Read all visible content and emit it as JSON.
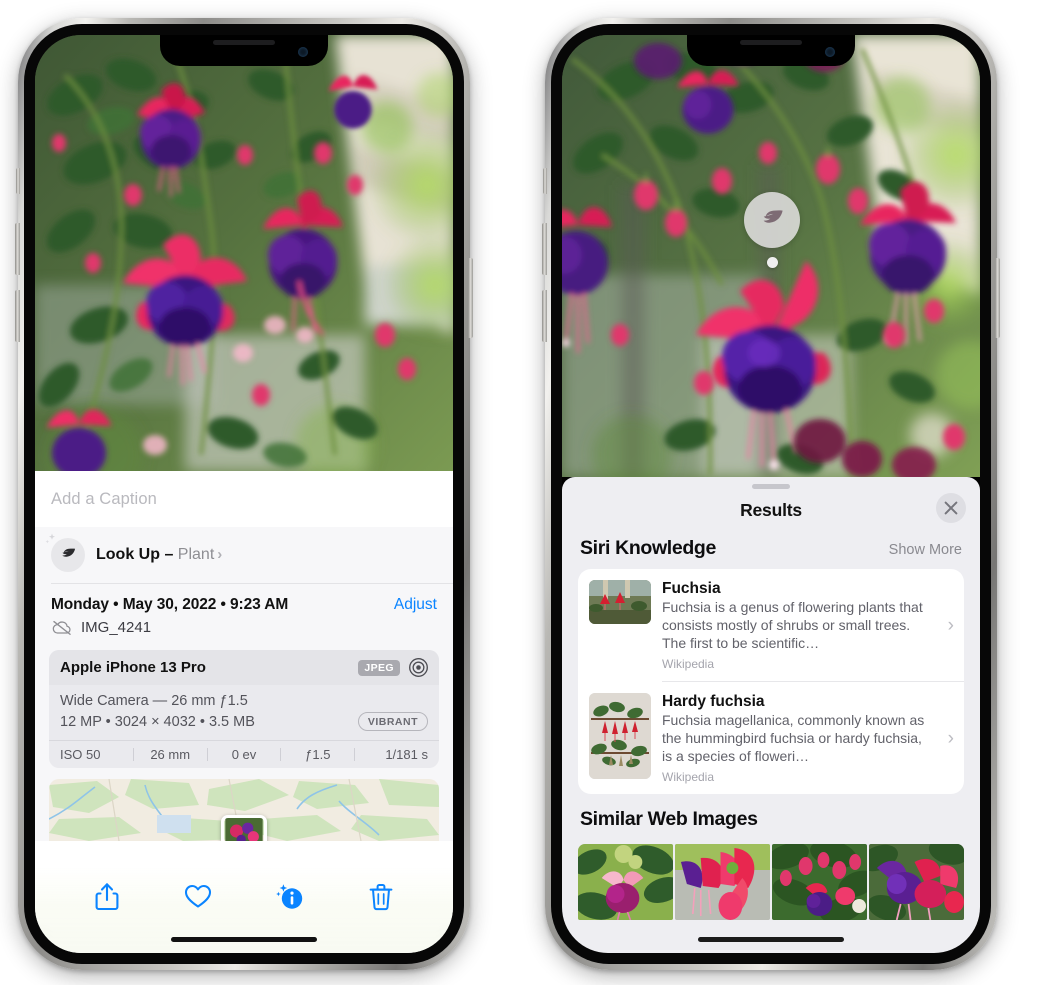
{
  "left_phone": {
    "caption_field": {
      "placeholder": "Add a Caption",
      "value": ""
    },
    "lookup_row": {
      "label": "Look Up –",
      "subject": "Plant",
      "chevron": "›",
      "icon": "leaf-sparkle-icon"
    },
    "metadata": {
      "date_line": "Monday • May 30, 2022 • 9:23 AM",
      "adjust_label": "Adjust",
      "filename": "IMG_4241",
      "cloud_icon": "cloud-slash-icon"
    },
    "camera_card": {
      "device": "Apple iPhone 13 Pro",
      "format_badge": "JPEG",
      "aperture_icon": "aperture-icon",
      "lens": "Wide Camera — 26 mm ƒ1.5",
      "specs": "12 MP • 3024 × 4032 • 3.5 MB",
      "style_badge": "VIBRANT",
      "exif": [
        "ISO 50",
        "26 mm",
        "0 ev",
        "ƒ1.5",
        "1/181 s"
      ]
    },
    "toolbar": [
      {
        "name": "share-button",
        "icon": "share-icon"
      },
      {
        "name": "favorite-button",
        "icon": "heart-icon"
      },
      {
        "name": "info-button",
        "icon": "info-sparkle-icon",
        "active": true
      },
      {
        "name": "delete-button",
        "icon": "trash-icon"
      }
    ]
  },
  "right_phone": {
    "badge": {
      "icon": "leaf-icon",
      "name": "visual-lookup-badge"
    },
    "sheet": {
      "title": "Results",
      "close_icon": "close-icon",
      "grabber": "drag-handle"
    },
    "siri_knowledge": {
      "title": "Siri Knowledge",
      "show_more": "Show More",
      "items": [
        {
          "name": "Fuchsia",
          "description": "Fuchsia is a genus of flowering plants that consists mostly of shrubs or small trees. The first to be scientific…",
          "source": "Wikipedia",
          "chevron": "›"
        },
        {
          "name": "Hardy fuchsia",
          "description": "Fuchsia magellanica, commonly known as the hummingbird fuchsia or hardy fuchsia, is a species of floweri…",
          "source": "Wikipedia",
          "chevron": "›"
        }
      ]
    },
    "similar_web_images": {
      "title": "Similar Web Images",
      "thumbnails": [
        "web-image-1",
        "web-image-2",
        "web-image-3",
        "web-image-4"
      ]
    }
  },
  "colors": {
    "accent_blue": "#0a84ff",
    "sheet_bg": "#eeeef2",
    "card_bg": "#ffffff",
    "muted_text": "#8e8e93"
  }
}
